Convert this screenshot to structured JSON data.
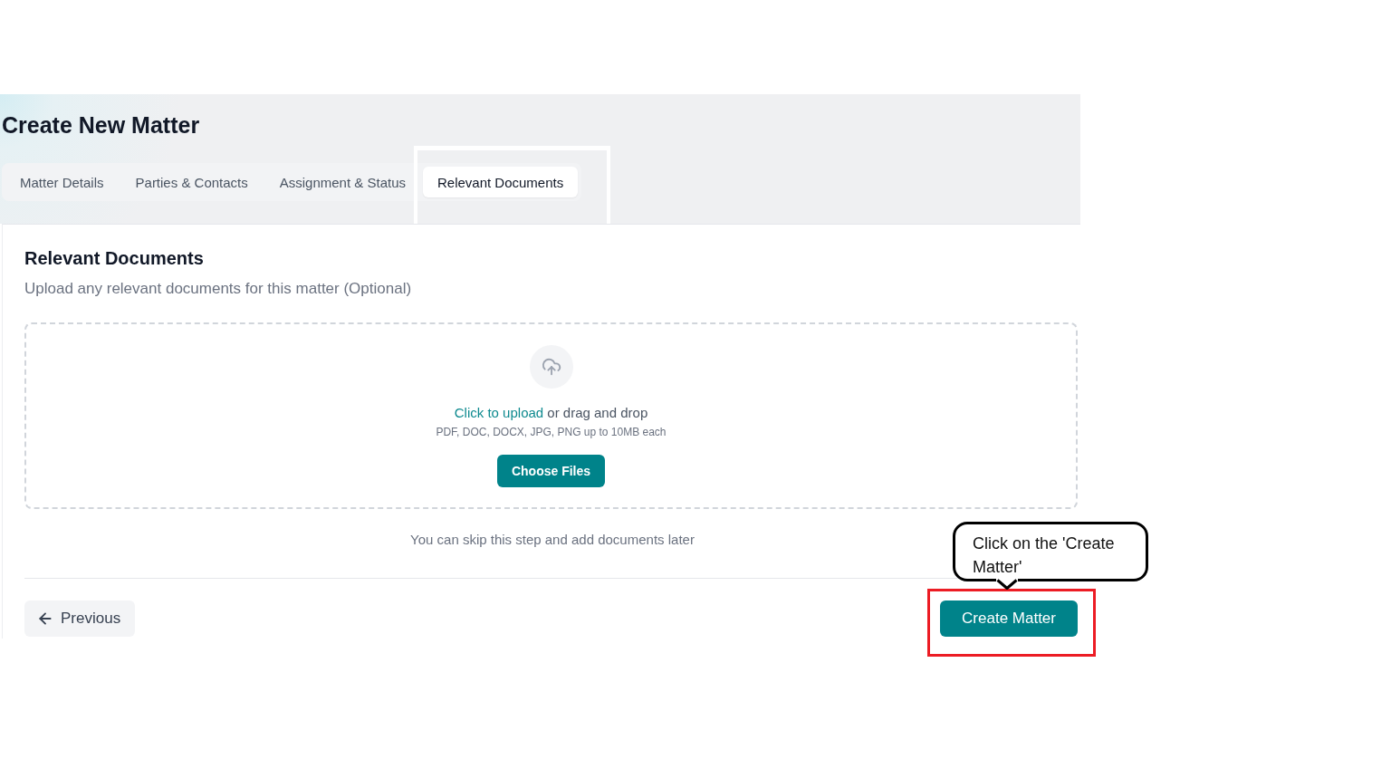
{
  "page": {
    "title": "Create New Matter"
  },
  "tabs": [
    {
      "label": "Matter Details",
      "selected": false
    },
    {
      "label": "Parties & Contacts",
      "selected": false
    },
    {
      "label": "Assignment & Status",
      "selected": false
    },
    {
      "label": "Relevant Documents",
      "selected": true
    }
  ],
  "section": {
    "heading": "Relevant Documents",
    "subtitle": "Upload any relevant documents for this matter (Optional)"
  },
  "dropzone": {
    "link": "Click to upload",
    "prompt": "or drag and drop",
    "formats": "PDF, DOC, DOCX, JPG, PNG up to 10MB each",
    "button": "Choose Files"
  },
  "skip_note": "You can skip this step and add documents later",
  "footer": {
    "previous": "Previous",
    "create": "Create Matter"
  },
  "annotation": {
    "callout": "Click on the 'Create Matter'"
  }
}
